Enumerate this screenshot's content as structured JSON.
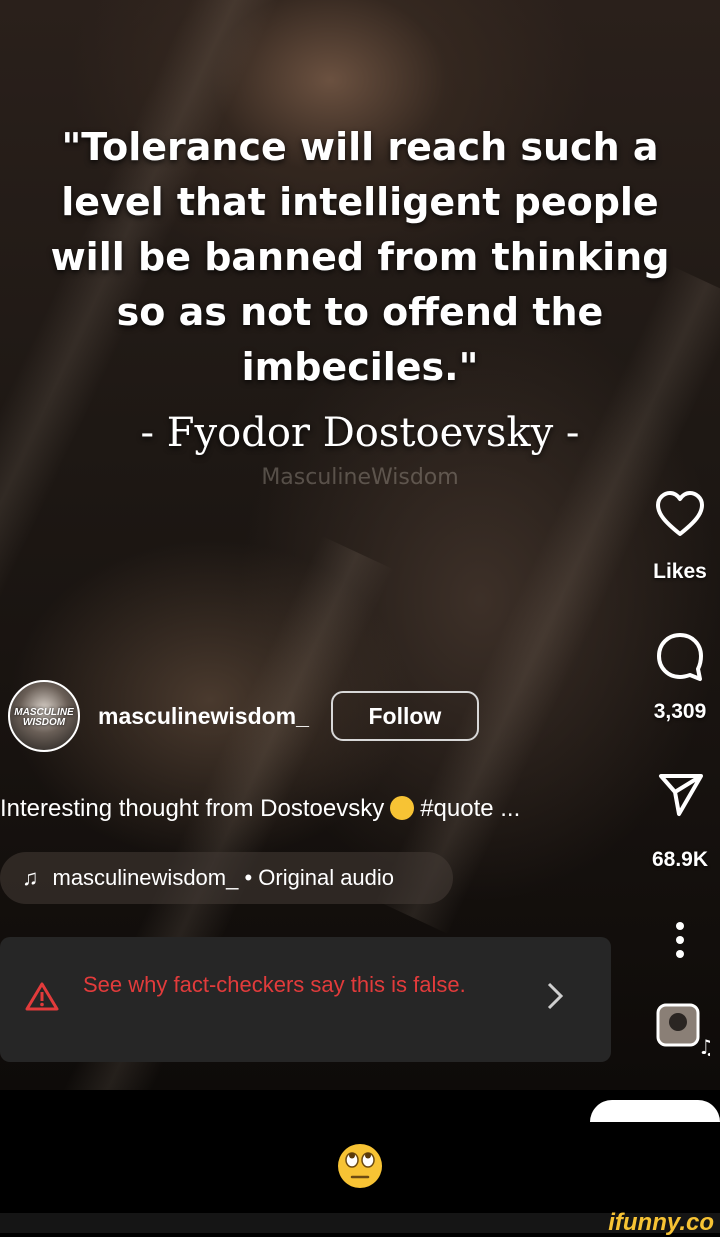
{
  "post": {
    "quote": "\"Tolerance will reach such a level that intelligent people will be banned from thinking so as not to offend the imbeciles.\"",
    "author": "- Fyodor Dostoevsky -",
    "watermark": "MasculineWisdom"
  },
  "actions": {
    "likes_label": "Likes",
    "comments_count": "3,309",
    "shares_count": "68.9K"
  },
  "profile": {
    "username": "masculinewisdom_",
    "avatar_text": "MASCULINE WISDOM",
    "follow_label": "Follow"
  },
  "caption": {
    "text": "Interesting thought from Dostoevsky",
    "hashtag": "#quote ..."
  },
  "audio": {
    "label": "masculinewisdom_ • Original audio"
  },
  "fact_check": {
    "text": "See why fact-checkers say this is false.",
    "color": "#e23b3b"
  },
  "footer": {
    "brand": "ifunny.co",
    "brand_color": "#f7c334"
  }
}
